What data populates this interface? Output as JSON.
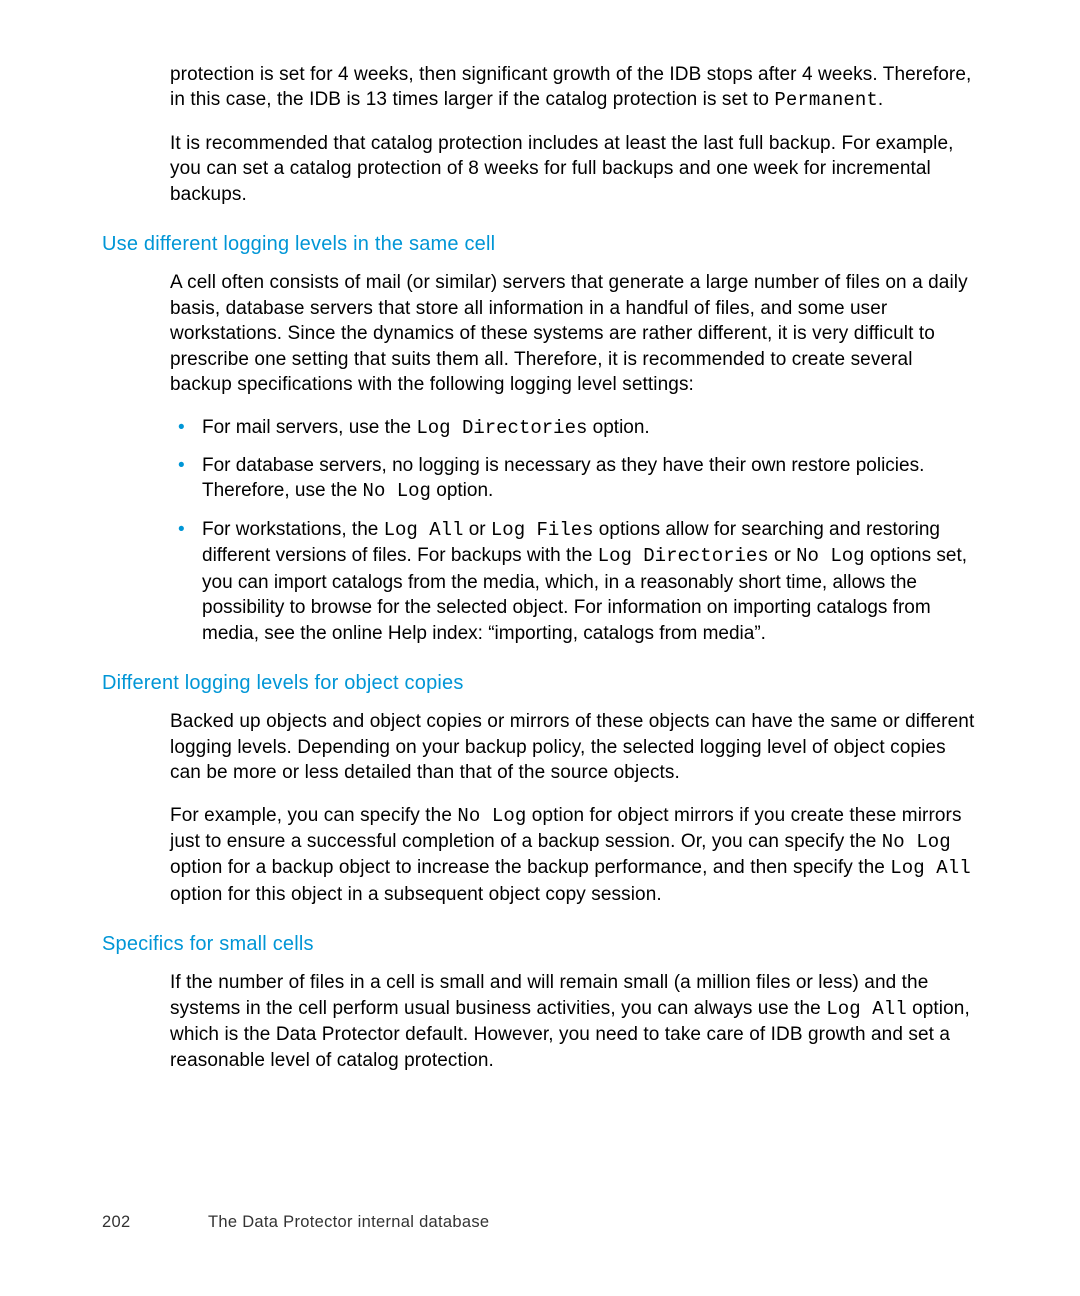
{
  "intro": {
    "p1a": "protection is set for 4 weeks, then significant growth of the IDB stops after 4 weeks. Therefore, in this case, the IDB is 13 times larger if the catalog protection is set to ",
    "p1code": "Permanent",
    "p1b": ".",
    "p2": "It is recommended that catalog protection includes at least the last full backup. For example, you can set a catalog protection of 8 weeks for full backups and one week for incremental backups."
  },
  "sec1": {
    "heading": "Use different logging levels in the same cell",
    "p1": "A cell often consists of mail (or similar) servers that generate a large number of files on a daily basis, database servers that store all information in a handful of files, and some user workstations. Since the dynamics of these systems are rather different, it is very difficult to prescribe one setting that suits them all. Therefore, it is recommended to create several backup specifications with the following logging level settings:",
    "li1a": "For mail servers, use the ",
    "li1code": "Log Directories",
    "li1b": " option.",
    "li2a": "For database servers, no logging is necessary as they have their own restore policies. Therefore, use the ",
    "li2code": "No Log",
    "li2b": " option.",
    "li3a": "For workstations, the ",
    "li3code1": "Log All",
    "li3b": " or ",
    "li3code2": "Log Files",
    "li3c": " options allow for searching and restoring different versions of files. For backups with the ",
    "li3code3": "Log Directories",
    "li3d": " or ",
    "li3code4": "No Log",
    "li3e": " options set, you can import catalogs from the media, which, in a reasonably short time, allows the possibility to browse for the selected object. For information on importing catalogs from media, see the online Help index: “importing, catalogs from media”."
  },
  "sec2": {
    "heading": "Different logging levels for object copies",
    "p1": "Backed up objects and object copies or mirrors of these objects can have the same or different logging levels. Depending on your backup policy, the selected logging level of object copies can be more or less detailed than that of the source objects.",
    "p2a": "For example, you can specify the ",
    "p2code1": "No Log",
    "p2b": " option for object mirrors if you create these mirrors just to ensure a successful completion of a backup session. Or, you can specify the ",
    "p2code2": "No Log",
    "p2c": " option for a backup object to increase the backup performance, and then specify the ",
    "p2code3": "Log All",
    "p2d": " option for this object in a subsequent object copy session."
  },
  "sec3": {
    "heading": "Specifics for small cells",
    "p1a": "If the number of files in a cell is small and will remain small (a million files or less) and the systems in the cell perform usual business activities, you can always use the ",
    "p1code": "Log All",
    "p1b": " option, which is the Data Protector default. However, you need to take care of IDB growth and set a reasonable level of catalog protection."
  },
  "footer": {
    "page": "202",
    "title": "The Data Protector internal database"
  }
}
